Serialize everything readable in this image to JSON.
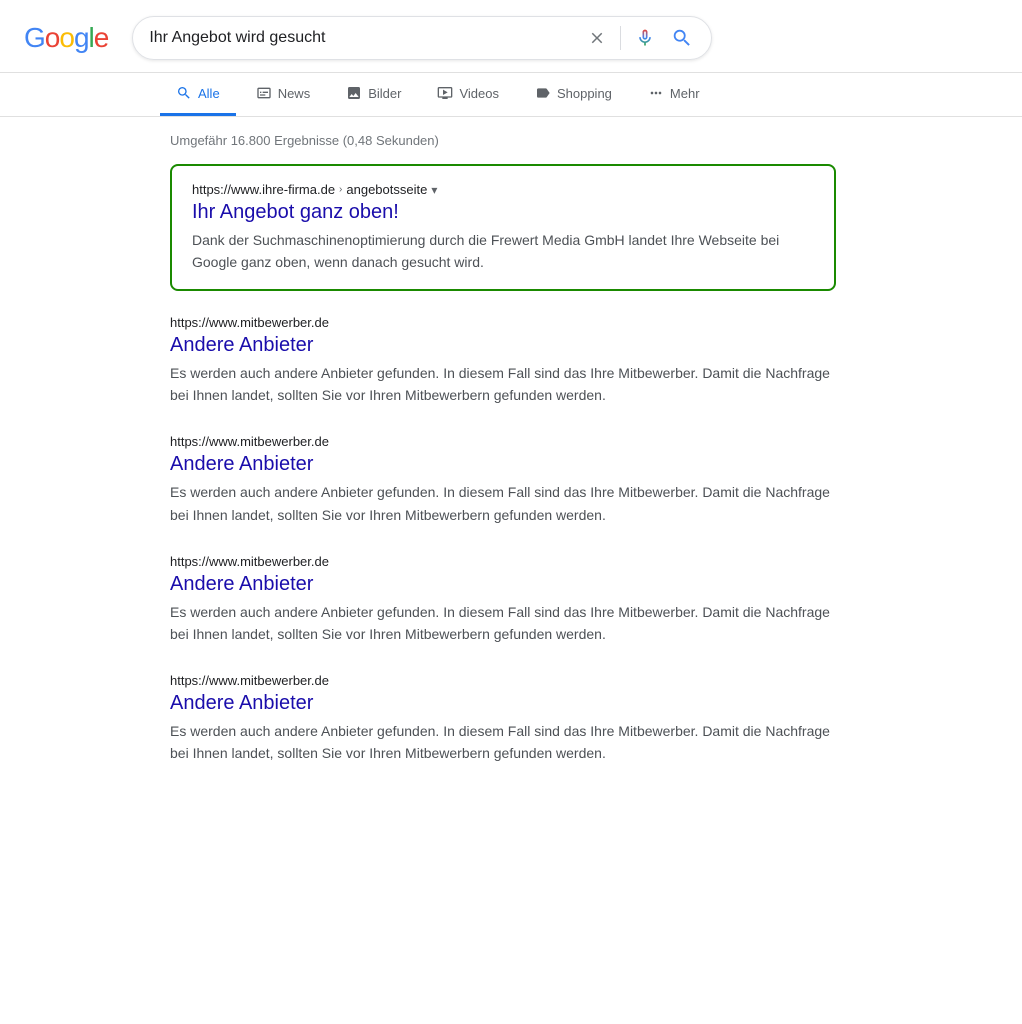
{
  "header": {
    "logo": {
      "letters": [
        {
          "char": "G",
          "color": "blue"
        },
        {
          "char": "o",
          "color": "red"
        },
        {
          "char": "o",
          "color": "yellow"
        },
        {
          "char": "g",
          "color": "blue"
        },
        {
          "char": "l",
          "color": "green"
        },
        {
          "char": "e",
          "color": "red"
        }
      ]
    },
    "search_query": "Ihr Angebot wird gesucht"
  },
  "nav": {
    "tabs": [
      {
        "id": "alle",
        "label": "Alle",
        "active": true,
        "icon": "search"
      },
      {
        "id": "news",
        "label": "News",
        "active": false,
        "icon": "news"
      },
      {
        "id": "bilder",
        "label": "Bilder",
        "active": false,
        "icon": "images"
      },
      {
        "id": "videos",
        "label": "Videos",
        "active": false,
        "icon": "play"
      },
      {
        "id": "shopping",
        "label": "Shopping",
        "active": false,
        "icon": "tag"
      },
      {
        "id": "mehr",
        "label": "Mehr",
        "active": false,
        "icon": "dots"
      }
    ]
  },
  "results": {
    "stats": "Umgefähr 16.800 Ergebnisse (0,48 Sekunden)",
    "featured": {
      "url": "https://www.ihre-firma.de",
      "breadcrumb": "angebotsseite",
      "title": "Ihr Angebot ganz oben!",
      "description": "Dank der Suchmaschinenoptimierung durch die Frewert Media GmbH landet Ihre Webseite bei Google ganz oben, wenn danach gesucht wird."
    },
    "items": [
      {
        "url": "https://www.mitbewerber.de",
        "title": "Andere Anbieter",
        "description": "Es werden auch andere Anbieter gefunden. In diesem Fall sind das Ihre Mitbewerber. Damit die Nachfrage bei Ihnen landet, sollten Sie vor Ihren Mitbewerbern gefunden werden."
      },
      {
        "url": "https://www.mitbewerber.de",
        "title": "Andere Anbieter",
        "description": "Es werden auch andere Anbieter gefunden. In diesem Fall sind das Ihre Mitbewerber. Damit die Nachfrage bei Ihnen landet, sollten Sie vor Ihren Mitbewerbern gefunden werden."
      },
      {
        "url": "https://www.mitbewerber.de",
        "title": "Andere Anbieter",
        "description": "Es werden auch andere Anbieter gefunden. In diesem Fall sind das Ihre Mitbewerber. Damit die Nachfrage bei Ihnen landet, sollten Sie vor Ihren Mitbewerbern gefunden werden."
      },
      {
        "url": "https://www.mitbewerber.de",
        "title": "Andere Anbieter",
        "description": "Es werden auch andere Anbieter gefunden. In diesem Fall sind das Ihre Mitbewerber. Damit die Nachfrage bei Ihnen landet, sollten Sie vor Ihren Mitbewerbern gefunden werden."
      }
    ]
  }
}
